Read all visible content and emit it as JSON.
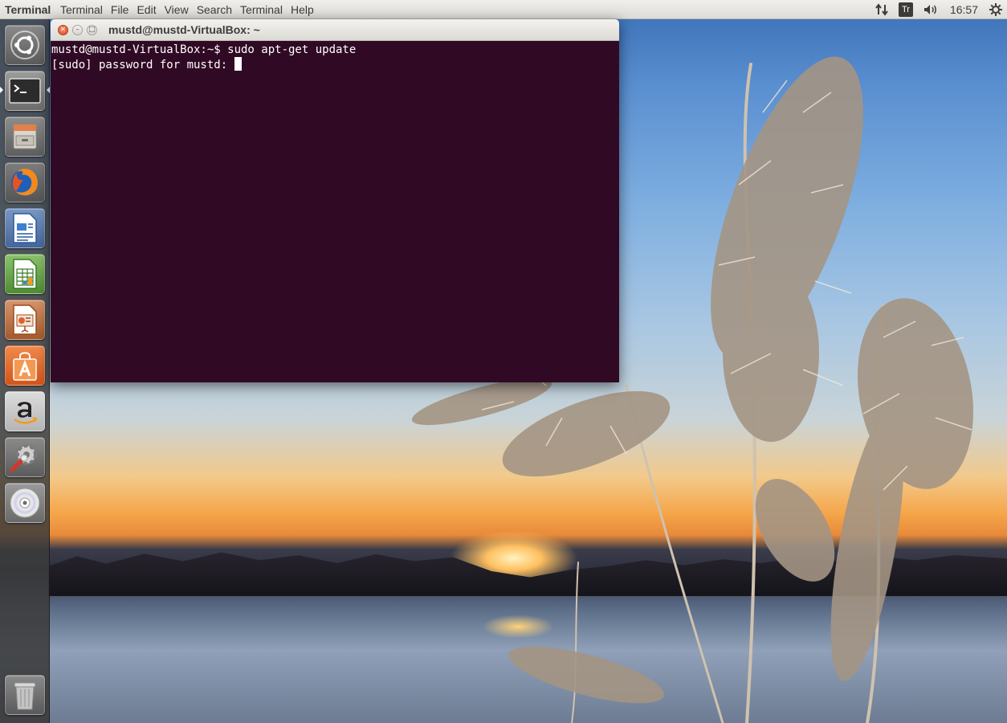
{
  "top_panel": {
    "app_name": "Terminal",
    "menu": [
      "Terminal",
      "File",
      "Edit",
      "View",
      "Search",
      "Terminal",
      "Help"
    ],
    "keyboard_indicator": "Tr",
    "clock": "16:57"
  },
  "launcher": {
    "items": [
      {
        "name": "dash-home",
        "icon": "ubuntu-logo-icon"
      },
      {
        "name": "terminal",
        "icon": "terminal-icon",
        "running": true
      },
      {
        "name": "files",
        "icon": "file-cabinet-icon"
      },
      {
        "name": "firefox",
        "icon": "firefox-icon"
      },
      {
        "name": "libreoffice-writer",
        "icon": "writer-document-icon"
      },
      {
        "name": "libreoffice-calc",
        "icon": "calc-spreadsheet-icon"
      },
      {
        "name": "libreoffice-impress",
        "icon": "impress-presentation-icon"
      },
      {
        "name": "ubuntu-software-center",
        "icon": "software-center-bag-icon"
      },
      {
        "name": "amazon",
        "icon": "amazon-icon"
      },
      {
        "name": "system-settings",
        "icon": "settings-gear-wrench-icon"
      },
      {
        "name": "dvd-drive",
        "icon": "cd-disc-icon"
      },
      {
        "name": "trash",
        "icon": "trash-icon"
      }
    ]
  },
  "terminal_window": {
    "title": "mustd@mustd-VirtualBox: ~",
    "close_glyph": "×",
    "minimize_glyph": "–",
    "maximize_glyph": "□",
    "lines": [
      "mustd@mustd-VirtualBox:~$ sudo apt-get update",
      "[sudo] password for mustd: "
    ]
  },
  "colors": {
    "terminal_bg": "#300a24",
    "terminal_fg": "#ffffff",
    "close_button": "#df4a1d",
    "panel_bg": "#dedcd6"
  }
}
